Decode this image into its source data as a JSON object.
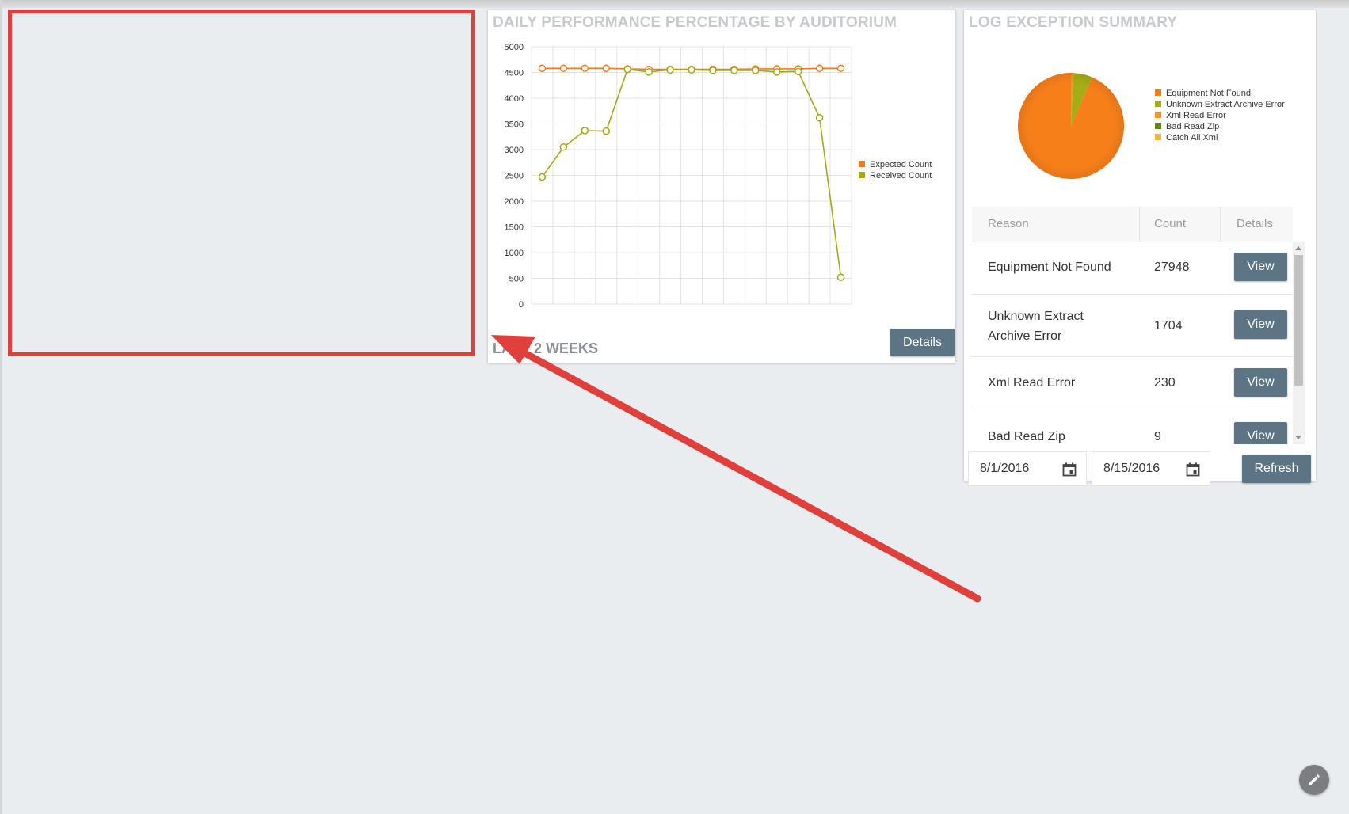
{
  "colors": {
    "expected": "#f47a20",
    "received": "#a3a815",
    "button": "#5b7584",
    "annotation": "#e0403c"
  },
  "performance_card": {
    "title": "DAILY PERFORMANCE PERCENTAGE BY AUDITORIUM",
    "period_label": "LAST 2 WEEKS",
    "details_button": "Details"
  },
  "chart_data": [
    {
      "type": "line",
      "title": "DAILY PERFORMANCE PERCENTAGE BY AUDITORIUM",
      "y_ticks": [
        "5000",
        "4500",
        "4000",
        "3500",
        "3000",
        "2500",
        "2000",
        "1500",
        "1000",
        "500",
        "0"
      ],
      "ylim": [
        0,
        5000
      ],
      "x": [
        1,
        2,
        3,
        4,
        5,
        6,
        7,
        8,
        9,
        10,
        11,
        12,
        13,
        14,
        15
      ],
      "grid": true,
      "legend": "right",
      "series": [
        {
          "name": "Expected Count",
          "values": [
            4580,
            4580,
            4580,
            4580,
            4570,
            4560,
            4560,
            4560,
            4560,
            4560,
            4570,
            4570,
            4570,
            4580,
            4580
          ]
        },
        {
          "name": "Received Count",
          "values": [
            2470,
            3050,
            3370,
            3360,
            4560,
            4510,
            4550,
            4550,
            4540,
            4540,
            4540,
            4510,
            4520,
            3620,
            520
          ]
        }
      ]
    },
    {
      "type": "pie",
      "title": "LOG EXCEPTION SUMMARY",
      "legend": "right",
      "slices": [
        {
          "name": "Equipment Not Found",
          "value": 27948,
          "color": "#f77f1a"
        },
        {
          "name": "Unknown Extract Archive Error",
          "value": 1704,
          "color": "#a3ad16"
        },
        {
          "name": "Xml Read Error",
          "value": 230,
          "color": "#f5961e"
        },
        {
          "name": "Bad Read Zip",
          "value": 9,
          "color": "#5e8a12"
        },
        {
          "name": "Catch All Xml",
          "value": 0,
          "color": "#f8b441"
        }
      ]
    }
  ],
  "exceptions_card": {
    "title": "LOG EXCEPTION SUMMARY",
    "headers": {
      "reason": "Reason",
      "count": "Count",
      "details": "Details"
    },
    "rows": [
      {
        "reason": "Equipment Not Found",
        "count": "27948",
        "button": "View"
      },
      {
        "reason_line1": "Unknown Extract",
        "reason_line2": "Archive Error",
        "count": "1704",
        "button": "View"
      },
      {
        "reason": "Xml Read Error",
        "count": "230",
        "button": "View"
      },
      {
        "reason": "Bad Read Zip",
        "count": "9",
        "button": "View"
      }
    ],
    "start_date": "8/1/2016",
    "end_date": "8/15/2016",
    "refresh_button": "Refresh"
  },
  "icons": {
    "calendar": "calendar-icon",
    "edit": "pencil-icon"
  }
}
